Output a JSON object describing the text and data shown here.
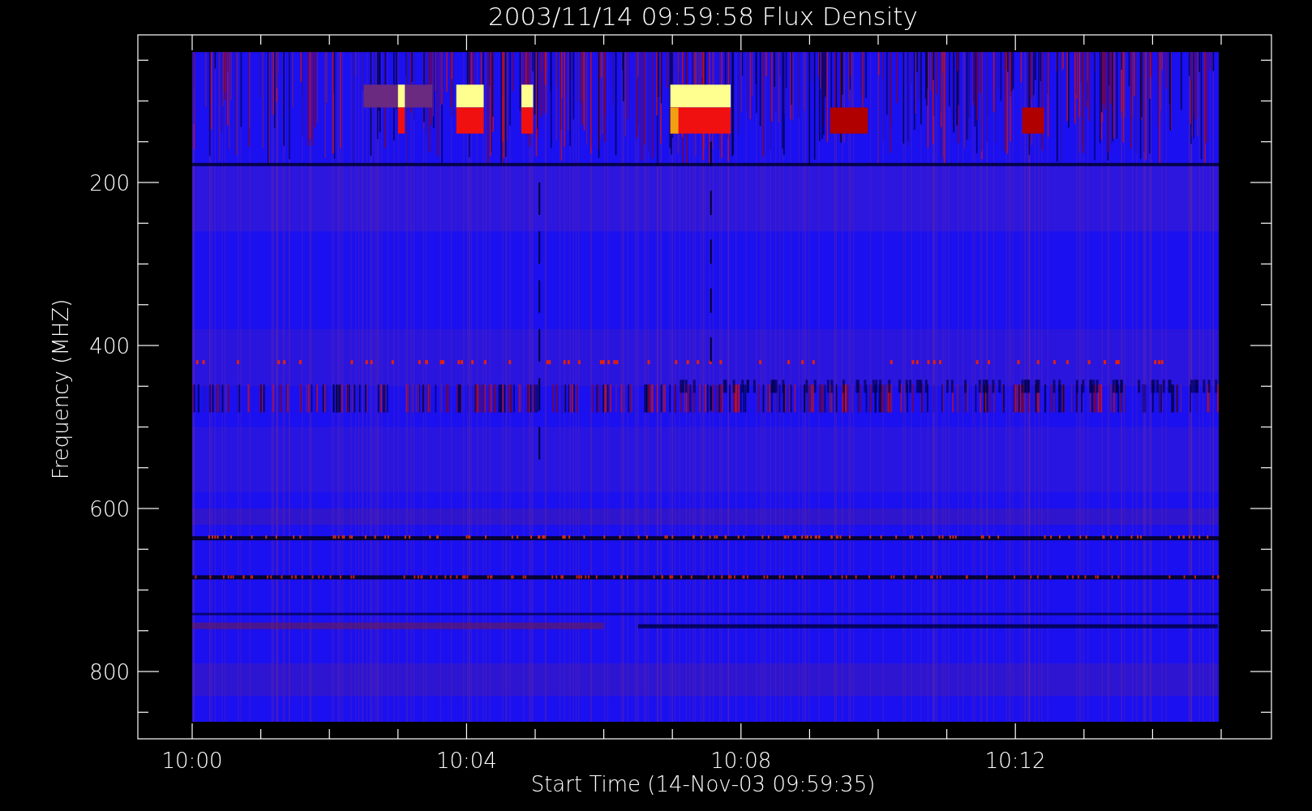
{
  "title": "2003/11/14 09:59:58 Flux Density",
  "y_axis": {
    "label": "Frequency (MHZ)",
    "ticks": [
      "200",
      "400",
      "600",
      "800"
    ]
  },
  "x_axis": {
    "label": "Start Time (14-Nov-03 09:59:35)",
    "ticks": [
      "10:00",
      "10:04",
      "10:08",
      "10:12"
    ]
  }
}
